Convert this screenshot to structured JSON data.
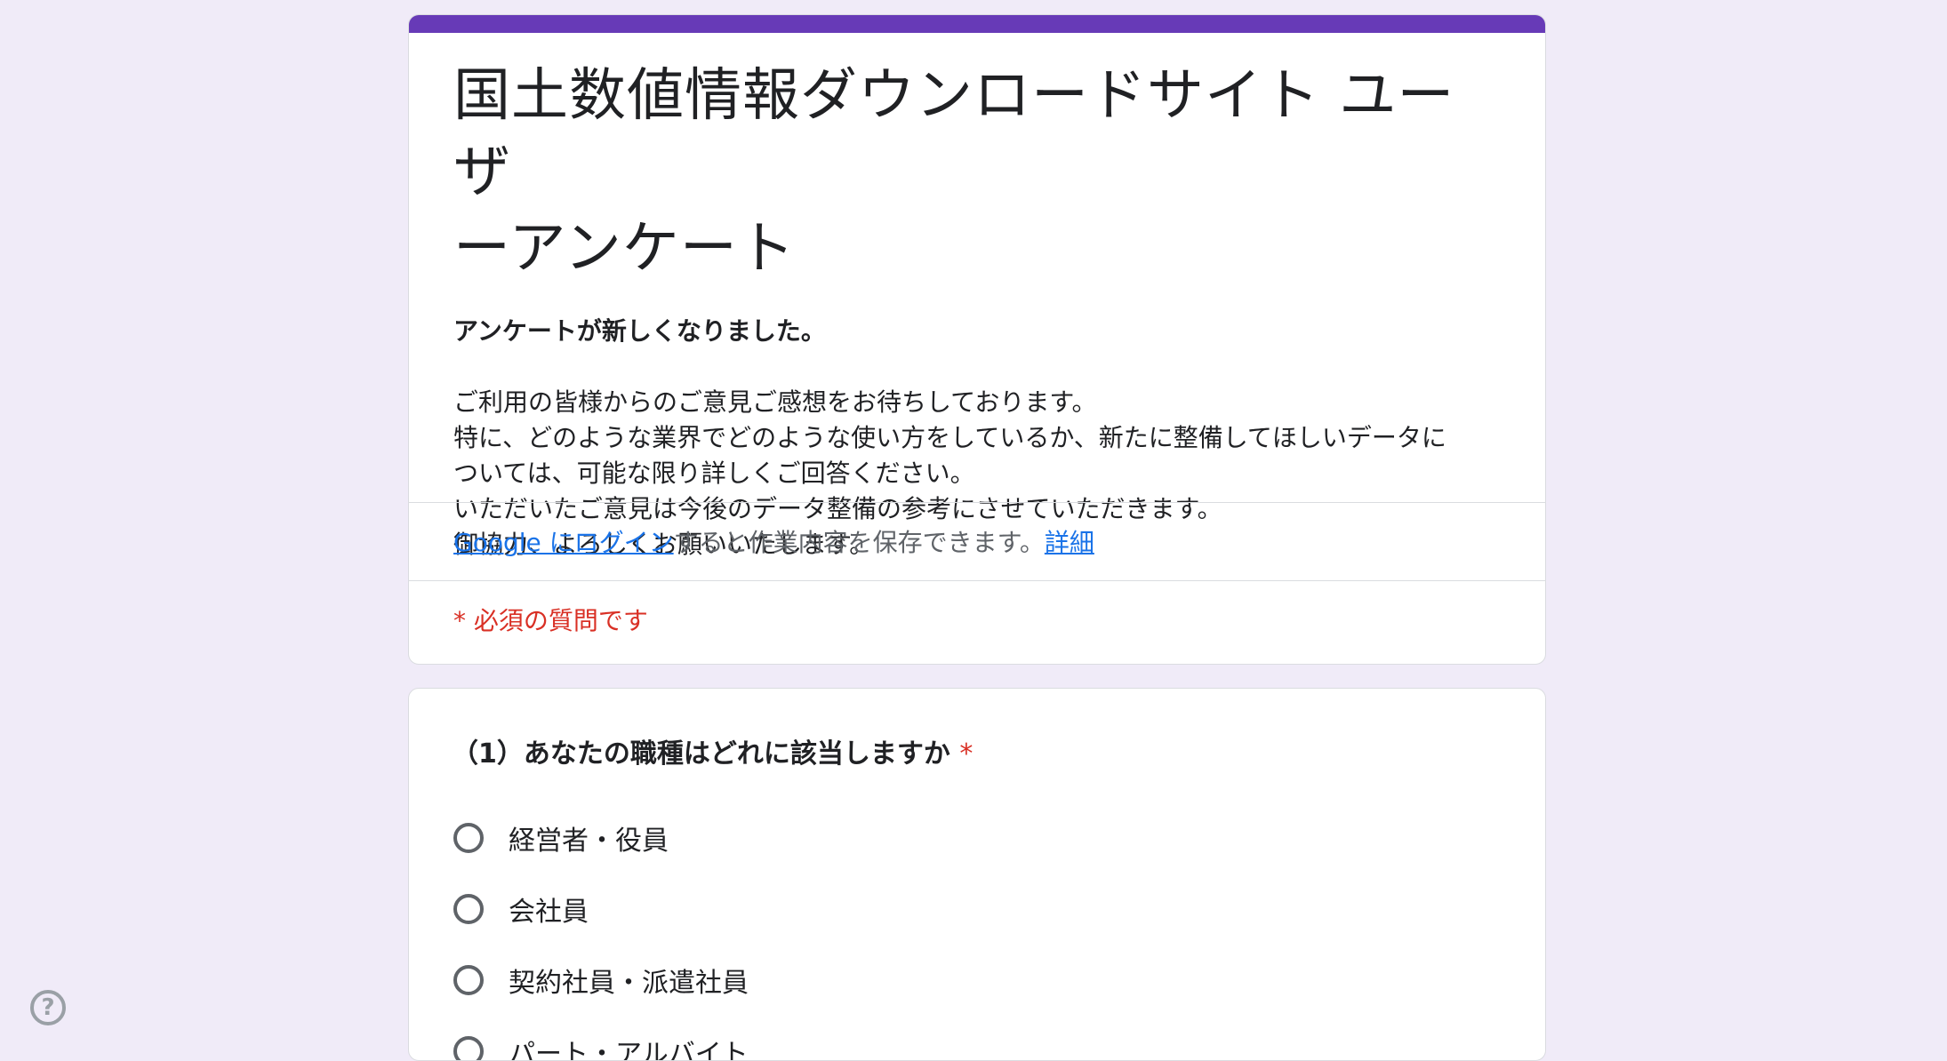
{
  "form": {
    "title_line1": "国土数値情報ダウンロードサイト ユーザ",
    "title_line2": "ーアンケート",
    "description_bold": "アンケートが新しくなりました。",
    "description_lines": [
      "ご利用の皆様からのご意見ご感想をお待ちしております。",
      "特に、どのような業界でどのような使い方をしているか、新たに整備してほしいデータに",
      "ついては、可能な限り詳しくご回答ください。",
      "いただいたご意見は今後のデータ整備の参考にさせていただきます。",
      "御協力、よろしくお願いいたします。"
    ],
    "login_link": "Google にログイン",
    "login_text": "すると作業内容を保存できます。",
    "details_link": "詳細",
    "required_note": "* 必須の質問です"
  },
  "question1": {
    "title": "（1）あなたの職種はどれに該当しますか",
    "required_mark": "*",
    "options": [
      {
        "label": "経営者・役員"
      },
      {
        "label": "会社員"
      },
      {
        "label": "契約社員・派遣社員"
      },
      {
        "label": "パート・アルバイト"
      }
    ]
  },
  "help": {
    "icon": "help-circle-icon",
    "glyph": "?"
  },
  "colors": {
    "background": "#f0ebf8",
    "accent": "#673ab7",
    "required": "#d93025",
    "link": "#1a73e8"
  }
}
